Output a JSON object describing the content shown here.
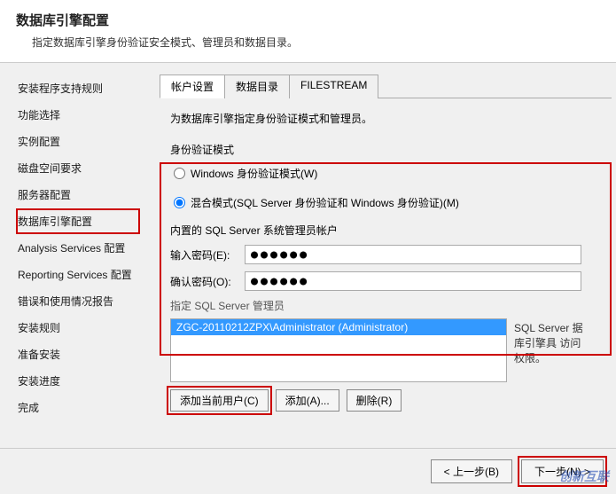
{
  "header": {
    "title": "数据库引擎配置",
    "subtitle": "指定数据库引擎身份验证安全模式、管理员和数据目录。"
  },
  "sidebar": {
    "items": [
      "安装程序支持规则",
      "功能选择",
      "实例配置",
      "磁盘空间要求",
      "服务器配置",
      "数据库引擎配置",
      "Analysis Services 配置",
      "Reporting Services 配置",
      "错误和使用情况报告",
      "安装规则",
      "准备安装",
      "安装进度",
      "完成"
    ],
    "active_index": 5
  },
  "tabs": {
    "items": [
      "帐户设置",
      "数据目录",
      "FILESTREAM"
    ],
    "active_index": 0
  },
  "content": {
    "intro": "为数据库引擎指定身份验证模式和管理员。",
    "auth_mode_label": "身份验证模式",
    "radio_windows": "Windows 身份验证模式(W)",
    "radio_mixed": "混合模式(SQL Server 身份验证和 Windows 身份验证)(M)",
    "builtin_label": "内置的 SQL Server 系统管理员帐户",
    "password_label": "输入密码(E):",
    "password_value": "●●●●●●",
    "confirm_label": "确认密码(O):",
    "confirm_value": "●●●●●●",
    "admins_label": "指定 SQL Server 管理员",
    "admins": [
      "ZGC-20110212ZPX\\Administrator (Administrator)"
    ],
    "side_text": "SQL Server 据库引擎具 访问权限。",
    "btn_add_current": "添加当前用户(C)",
    "btn_add": "添加(A)...",
    "btn_remove": "删除(R)"
  },
  "footer": {
    "back": "< 上一步(B)",
    "next": "下一步(N) >"
  },
  "watermark": "创新互联"
}
